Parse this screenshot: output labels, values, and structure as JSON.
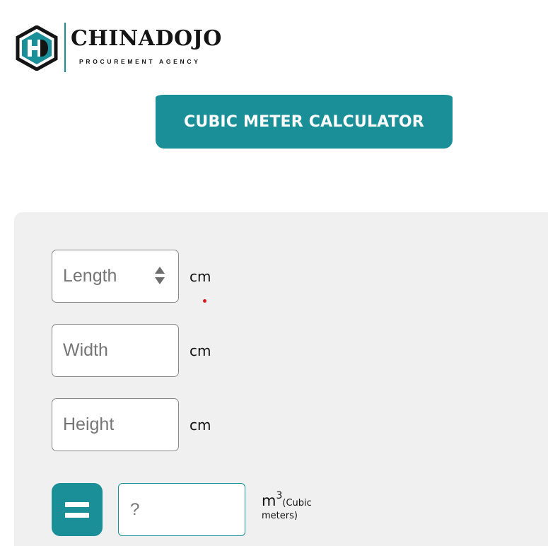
{
  "logo": {
    "name": "CHINADOJO",
    "tagline": "PROCUREMENT AGENCY",
    "icon": "hd-hexagon-logo-icon",
    "accent": "#1b8f98"
  },
  "header": {
    "title_button": "CUBIC METER CALCULATOR"
  },
  "calculator": {
    "length": {
      "placeholder": "Length",
      "unit": "cm"
    },
    "width": {
      "placeholder": "Width",
      "unit": "cm"
    },
    "height": {
      "placeholder": "Height",
      "unit": "cm"
    },
    "equals_icon": "equals-icon",
    "result": {
      "placeholder": "?",
      "unit_base": "m",
      "unit_exponent": "3",
      "unit_desc_1": "(Cubic",
      "unit_desc_2": "meters)"
    }
  },
  "colors": {
    "accent": "#1b8f98",
    "panel_background": "#f0f0f0"
  }
}
